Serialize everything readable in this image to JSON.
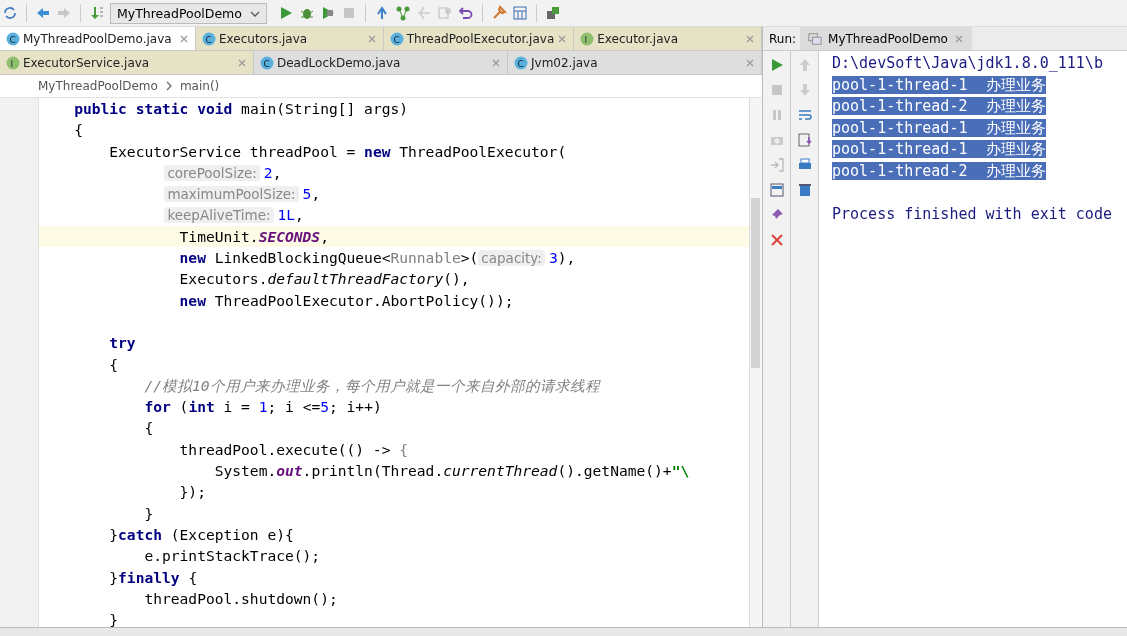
{
  "toolbar": {
    "run_config": "MyThreadPoolDemo"
  },
  "editor_tabs": [
    [
      {
        "label": "MyThreadPoolDemo.java",
        "kind": "class",
        "icon_letter": "C",
        "selected": true
      },
      {
        "label": "Executors.java",
        "kind": "class",
        "icon_letter": "C",
        "selected": false
      },
      {
        "label": "ThreadPoolExecutor.java",
        "kind": "class",
        "icon_letter": "C",
        "selected": false
      },
      {
        "label": "Executor.java",
        "kind": "interface",
        "icon_letter": "I",
        "selected": false
      }
    ],
    [
      {
        "label": "ExecutorService.java",
        "kind": "interface",
        "icon_letter": "I",
        "selected": false
      },
      {
        "label": "DeadLockDemo.java",
        "kind": "class",
        "icon_letter": "C",
        "selected": false
      },
      {
        "label": "Jvm02.java",
        "kind": "class",
        "icon_letter": "C",
        "selected": false
      }
    ]
  ],
  "breadcrumb": [
    "MyThreadPoolDemo",
    "main()"
  ],
  "code_lines": [
    {
      "current": false,
      "tokens": [
        {
          "kind": "kw",
          "text": "    public static void "
        },
        {
          "kind": "txt",
          "text": "main(String[] args)"
        }
      ]
    },
    {
      "current": false,
      "tokens": [
        {
          "kind": "txt",
          "text": "    {"
        }
      ]
    },
    {
      "current": false,
      "tokens": [
        {
          "kind": "txt",
          "text": "        ExecutorService threadPool = "
        },
        {
          "kind": "kw",
          "text": "new "
        },
        {
          "kind": "txt",
          "text": "ThreadPoolExecutor("
        }
      ]
    },
    {
      "current": false,
      "tokens": [
        {
          "kind": "hint",
          "text": "corePoolSize:"
        },
        {
          "kind": "num",
          "text": "2"
        },
        {
          "kind": "txt",
          "text": ","
        }
      ]
    },
    {
      "current": false,
      "tokens": [
        {
          "kind": "hint",
          "text": "maximumPoolSize:"
        },
        {
          "kind": "num",
          "text": "5"
        },
        {
          "kind": "txt",
          "text": ","
        }
      ]
    },
    {
      "current": false,
      "tokens": [
        {
          "kind": "hint",
          "text": "keepAliveTime:"
        },
        {
          "kind": "num",
          "text": "1L"
        },
        {
          "kind": "txt",
          "text": ","
        }
      ]
    },
    {
      "current": true,
      "tokens": [
        {
          "kind": "txt",
          "text": "                TimeUnit."
        },
        {
          "kind": "static",
          "text": "SECONDS"
        },
        {
          "kind": "txt",
          "text": ","
        }
      ]
    },
    {
      "current": false,
      "tokens": [
        {
          "kind": "kw",
          "text": "                new "
        },
        {
          "kind": "txt",
          "text": "LinkedBlockingQueue<"
        },
        {
          "kind": "generic",
          "text": "Runnable"
        },
        {
          "kind": "txt",
          "text": ">("
        },
        {
          "kind": "hint",
          "text": "capacity:"
        },
        {
          "kind": "num",
          "text": "3"
        },
        {
          "kind": "txt",
          "text": "),"
        }
      ]
    },
    {
      "current": false,
      "tokens": [
        {
          "kind": "txt",
          "text": "                Executors."
        },
        {
          "kind": "ital",
          "text": "defaultThreadFactory"
        },
        {
          "kind": "txt",
          "text": "(),"
        }
      ]
    },
    {
      "current": false,
      "tokens": [
        {
          "kind": "kw",
          "text": "                new "
        },
        {
          "kind": "txt",
          "text": "ThreadPoolExecutor.AbortPolicy());"
        }
      ]
    },
    {
      "current": false
    },
    {
      "current": false,
      "tokens": [
        {
          "kind": "kw",
          "text": "        try"
        }
      ]
    },
    {
      "current": false,
      "tokens": [
        {
          "kind": "txt",
          "text": "        {"
        }
      ]
    },
    {
      "current": false,
      "tokens": [
        {
          "kind": "comment",
          "text": "            //模拟10个用户来办理业务，每个用户就是一个来自外部的请求线程"
        }
      ]
    },
    {
      "current": false,
      "tokens": [
        {
          "kind": "kw",
          "text": "            for "
        },
        {
          "kind": "txt",
          "text": "("
        },
        {
          "kind": "kw",
          "text": "int "
        },
        {
          "kind": "txt",
          "text": "i = "
        },
        {
          "kind": "num",
          "text": "1"
        },
        {
          "kind": "txt",
          "text": "; i <="
        },
        {
          "kind": "num",
          "text": "5"
        },
        {
          "kind": "txt",
          "text": "; i++)"
        }
      ]
    },
    {
      "current": false,
      "tokens": [
        {
          "kind": "txt",
          "text": "            {"
        }
      ]
    },
    {
      "current": false,
      "tokens": [
        {
          "kind": "txt",
          "text": "                threadPool.execute(() -> "
        },
        {
          "kind": "generic",
          "text": "{"
        }
      ]
    },
    {
      "current": false,
      "tokens": [
        {
          "kind": "txt",
          "text": "                    System."
        },
        {
          "kind": "static",
          "text": "out"
        },
        {
          "kind": "txt",
          "text": ".println(Thread."
        },
        {
          "kind": "ital",
          "text": "currentThread"
        },
        {
          "kind": "txt",
          "text": "().getName()+"
        },
        {
          "kind": "str",
          "text": "\"\\"
        }
      ]
    },
    {
      "current": false,
      "tokens": [
        {
          "kind": "txt",
          "text": "                });"
        }
      ]
    },
    {
      "current": false,
      "tokens": [
        {
          "kind": "txt",
          "text": "            }"
        }
      ]
    },
    {
      "current": false,
      "tokens": [
        {
          "kind": "txt",
          "text": "        }"
        },
        {
          "kind": "kw",
          "text": "catch "
        },
        {
          "kind": "txt",
          "text": "(Exception e){"
        }
      ]
    },
    {
      "current": false,
      "tokens": [
        {
          "kind": "txt",
          "text": "            e.printStackTrace();"
        }
      ]
    },
    {
      "current": false,
      "tokens": [
        {
          "kind": "txt",
          "text": "        }"
        },
        {
          "kind": "kw",
          "text": "finally "
        },
        {
          "kind": "txt",
          "text": "{"
        }
      ]
    },
    {
      "current": false,
      "tokens": [
        {
          "kind": "txt",
          "text": "            threadPool.shutdown();"
        }
      ]
    },
    {
      "current": false,
      "tokens": [
        {
          "kind": "txt",
          "text": "        }"
        }
      ]
    }
  ],
  "run_panel": {
    "label": "Run:",
    "tab": "MyThreadPoolDemo",
    "lines": [
      {
        "kind": "command",
        "text": "D:\\devSoft\\Java\\jdk1.8.0_111\\b",
        "selected": false
      },
      {
        "kind": "output",
        "text": "pool-1-thread-1  办理业务",
        "selected": true
      },
      {
        "kind": "output",
        "text": "pool-1-thread-2  办理业务",
        "selected": true
      },
      {
        "kind": "output",
        "text": "pool-1-thread-1  办理业务",
        "selected": true
      },
      {
        "kind": "output",
        "text": "pool-1-thread-1  办理业务",
        "selected": true
      },
      {
        "kind": "output",
        "text": "pool-1-thread-2  办理业务",
        "selected": true
      },
      {
        "kind": "status",
        "text": "Process finished with exit code",
        "selected": false
      }
    ]
  }
}
